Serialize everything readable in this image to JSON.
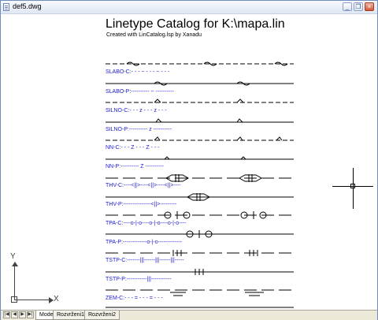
{
  "window": {
    "title": "def5.dwg"
  },
  "window_buttons": {
    "minimize": "_",
    "restore": "❐",
    "close": "×"
  },
  "drawing": {
    "heading": "Linetype Catalog for K:\\mapa.lin",
    "subheading": "Created with LinCatalog.lsp by Xanadu",
    "linetype_labels": [
      "SLABO-C:- - - ~ - - - ~ - - -",
      "SLABO-P:---------- ~ ----------",
      "SILNO-C:- - - z - - - z - - -",
      "SILNO-P:---------- z ----------",
      "NN-C:- - - Z - - - Z - - -",
      "NN-P:---------- Z ----------",
      "THV-C:----<||>----<||>----<||>----",
      "THV-P:---------------<||>---------",
      "TPA-C:----o-|-o----o-|-o----o-|-o----",
      "TPA-P:-------------o-|-o-------------",
      "TSTP-C:-------|||------|||------|||-----",
      "TSTP-P:-----------|||-----------",
      "ZEM-C:- - - = - - - = - - -"
    ]
  },
  "crosshair": {
    "icon": "crosshair-cursor"
  },
  "ucs": {
    "y_label": "Y",
    "x_label": "X"
  },
  "nav": {
    "first": "|◀",
    "prev": "◀",
    "next": "▶",
    "last": "▶|"
  },
  "tabs": [
    {
      "label": "Model",
      "active": true
    },
    {
      "label": "Rozvrženi1",
      "active": false
    },
    {
      "label": "Rozvrženi2",
      "active": false
    }
  ],
  "colors": {
    "label_blue": "#1a1ad0",
    "frame_border": "#6f8dbf",
    "tabbar_bg": "#ece9d8"
  }
}
